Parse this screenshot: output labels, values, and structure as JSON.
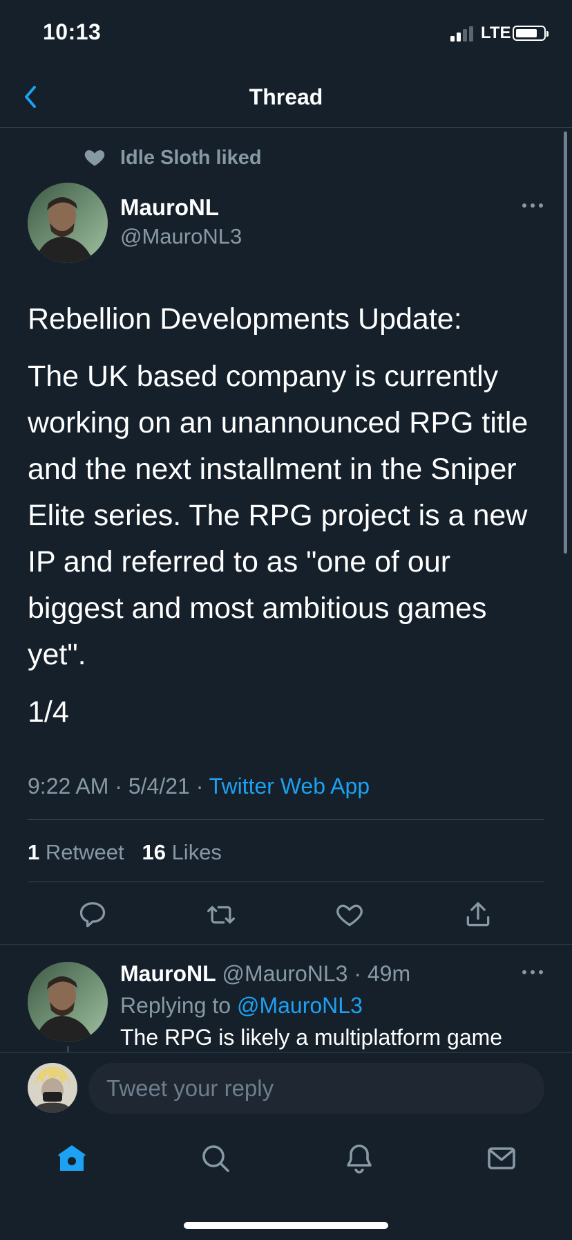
{
  "status_bar": {
    "time": "10:13",
    "network": "LTE"
  },
  "nav": {
    "title": "Thread"
  },
  "social_context": {
    "text": "Idle Sloth liked"
  },
  "tweet": {
    "author_name": "MauroNL",
    "author_handle": "@MauroNL3",
    "paragraphs": [
      "Rebellion Developments Update:",
      "The UK based company is currently working on an unannounced RPG title and the next installment in the Sniper Elite series. The RPG project is a new IP and referred to as \"one of our biggest and most ambitious games yet\".",
      "1/4"
    ],
    "time": "9:22 AM",
    "date": "5/4/21",
    "source": "Twitter Web App",
    "retweet_count": "1",
    "retweet_label": "Retweet",
    "like_count": "16",
    "like_label": "Likes"
  },
  "reply": {
    "author_name": "MauroNL",
    "author_handle": "@MauroNL3",
    "age": "49m",
    "replying_prefix": "Replying to",
    "replying_to": "@MauroNL3",
    "text": "The RPG is likely a multiplatform game"
  },
  "composer": {
    "placeholder": "Tweet your reply"
  },
  "colors": {
    "background": "#15202b",
    "accent": "#1da1f2",
    "secondary_text": "#8899a6",
    "divider": "#38444d"
  },
  "icons": {
    "back": "chevron-left-icon",
    "liked": "heart-icon",
    "more": "more-icon",
    "actions": [
      "reply-icon",
      "retweet-icon",
      "like-icon",
      "share-icon"
    ],
    "tabs": [
      "home-icon",
      "search-icon",
      "notifications-icon",
      "messages-icon"
    ]
  }
}
